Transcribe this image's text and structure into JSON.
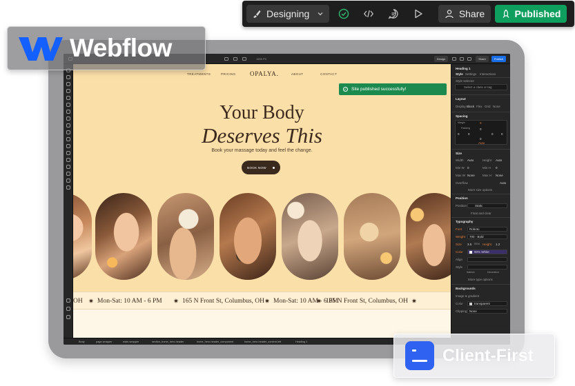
{
  "toolbar": {
    "mode_label": "Designing",
    "share_label": "Share",
    "publish_label": "Published",
    "accent": "#0e9e5e"
  },
  "badges": {
    "webflow_label": "Webflow",
    "client_first_label": "Client-First",
    "client_first_color": "#2f62f1"
  },
  "designer_top": {
    "width_readout": "1559 PX",
    "design_label": "Design",
    "share_label": "Share",
    "publish_label": "Publish"
  },
  "site": {
    "nav": [
      "TREATMENTS",
      "PRICING",
      "ABOUT",
      "CONTACT"
    ],
    "logo": "OPALYA.",
    "toast": "Site published successfully!",
    "headline_1": "Your Body",
    "headline_2": "Deserves This",
    "subtitle": "Book your massage today and feel the change.",
    "cta_label": "BOOK NOW",
    "ticker": [
      "OH",
      "Mon-Sat: 10 AM - 6 PM",
      "165 N Front St, Columbus, OH",
      "Mon-Sat: 10 AM - 6 PM",
      "165 N Front St, Columbus, OH"
    ],
    "bg_color": "#fbdfa8"
  },
  "panel": {
    "heading": "Heading 1",
    "tabs": [
      "Style",
      "Settings",
      "Interactions"
    ],
    "style_selector": "Style selector",
    "selector_placeholder": "Select a class or tag",
    "layout_title": "Layout",
    "display_label": "Display",
    "display_options": [
      "Block",
      "Flex",
      "Grid",
      "None"
    ],
    "spacing_title": "Spacing",
    "margin_label": "Margin",
    "padding_label": "Padding",
    "spacing_value": "0",
    "auto_label": "Auto",
    "size_title": "Size",
    "width_label": "Width",
    "width_value": "Auto",
    "height_label": "Height",
    "height_value": "Auto",
    "min_w_label": "Min W",
    "min_h_label": "Min H",
    "min_value": "0",
    "max_w_label": "Max W",
    "max_h_label": "Max H",
    "max_value": "None",
    "overflow_label": "Overflow",
    "more_size": "More size options",
    "position_title": "Position",
    "position_label": "Position",
    "position_value": "Static",
    "float_label": "Float and clear",
    "typography_title": "Typography",
    "font_label": "Font",
    "font_value": "Roboto",
    "weight_label": "Weight",
    "weight_value": "700 - Bold",
    "size_label": "Size",
    "size_value": "3.5",
    "size_unit": "REM",
    "lh_label": "Height",
    "lh_value": "1.2",
    "color_label": "Color",
    "color_value": "90% White",
    "align_label": "Align",
    "style_label": "Style",
    "italicize_label": "Italicize",
    "decoration_label": "Decoration",
    "more_type": "More type options",
    "backgrounds_title": "Backgrounds",
    "image_label": "Image & gradient",
    "bg_color_label": "Color",
    "bg_color_value": "transparent",
    "clipping_label": "Clipping",
    "clipping_value": "None"
  },
  "breadcrumb": [
    "Body",
    "page-wrapper",
    "main-wrapper",
    "section_home_hero-header",
    "home_hero-header_component",
    "home_hero-header_content-left",
    "Heading 1"
  ]
}
